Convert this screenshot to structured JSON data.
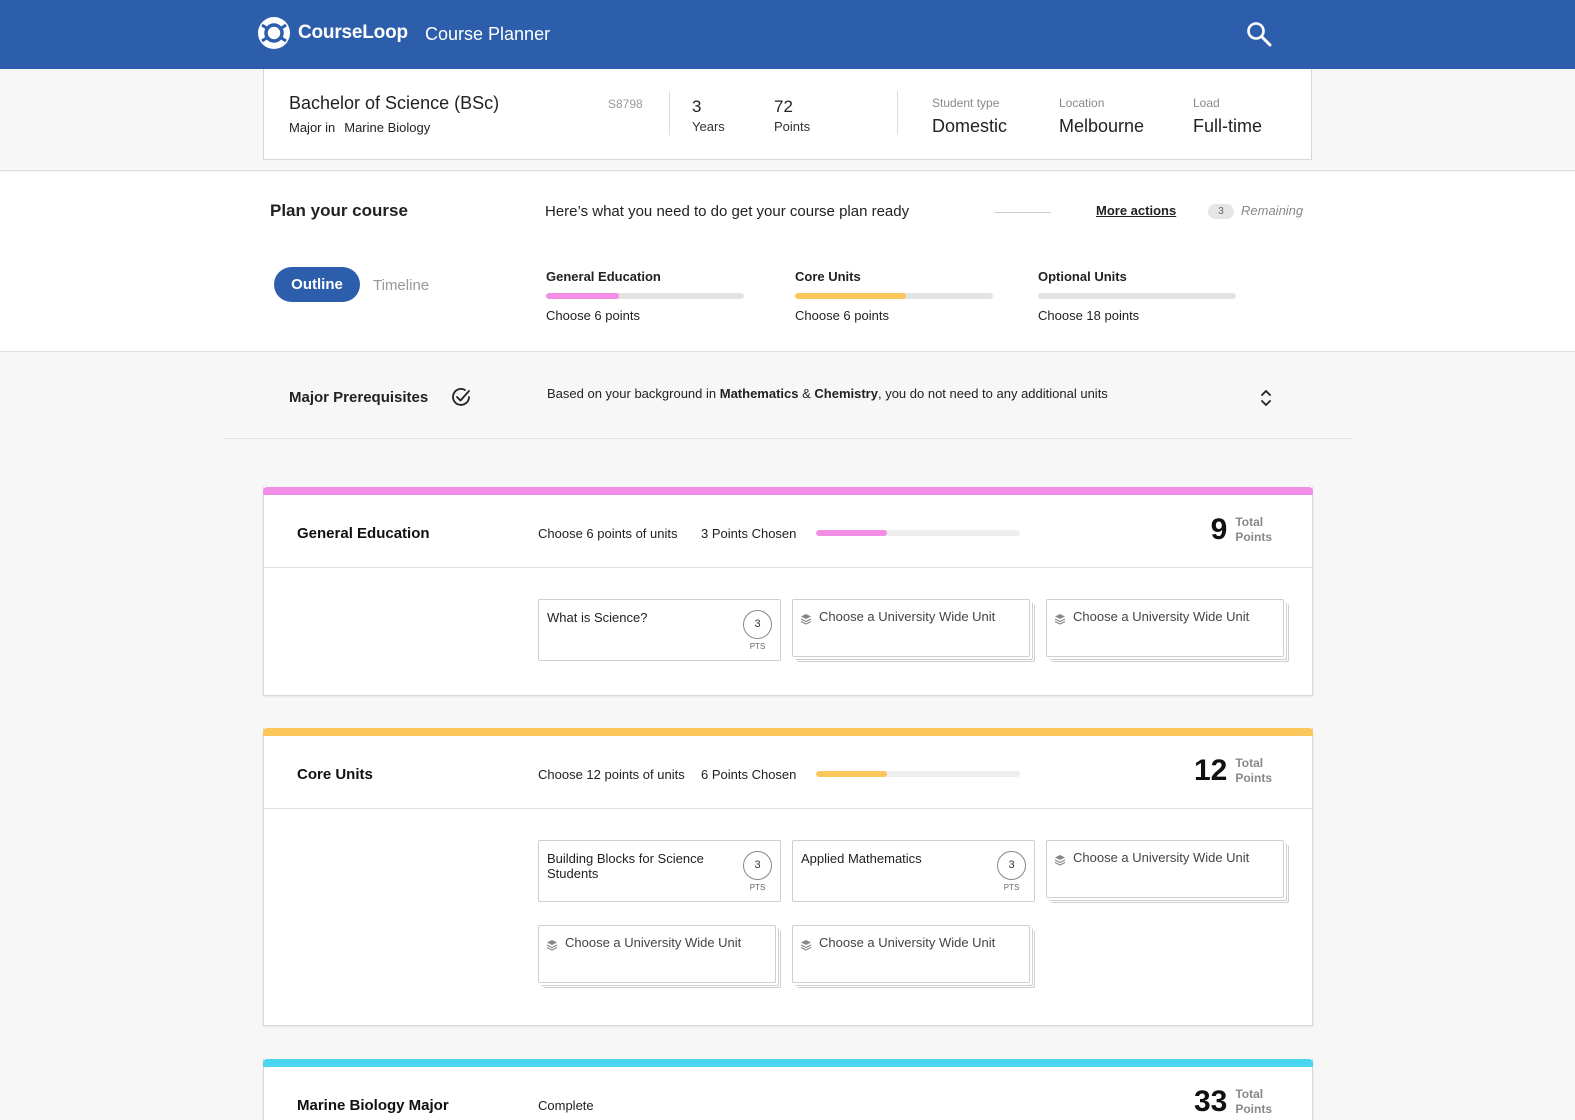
{
  "header": {
    "brand": "CourseLoop",
    "app_title": "Course Planner",
    "search_icon": "search-icon"
  },
  "summary": {
    "degree": "Bachelor of Science (BSc)",
    "major_label": "Major in",
    "major": "Marine Biology",
    "code": "S8798",
    "years_value": "3",
    "years_label": "Years",
    "points_value": "72",
    "points_label": "Points",
    "student_type_label": "Student type",
    "student_type": "Domestic",
    "location_label": "Location",
    "location": "Melbourne",
    "load_label": "Load",
    "load": "Full-time"
  },
  "plan": {
    "title": "Plan your course",
    "subtitle": "Here’s what you need to do get your course plan ready",
    "more_actions": "More actions",
    "remaining_count": "3",
    "remaining_label": "Remaining",
    "tabs": [
      {
        "label": "Outline",
        "active": true
      },
      {
        "label": "Timeline",
        "active": false
      }
    ],
    "requirements": [
      {
        "name": "General Education",
        "desc": "Choose 6 points",
        "progress": 0.37,
        "color": "#f28ee6"
      },
      {
        "name": "Core Units",
        "desc": "Choose 6 points",
        "progress": 0.56,
        "color": "#fcc75a"
      },
      {
        "name": "Optional Units",
        "desc": "Choose 18 points",
        "progress": 0,
        "color": "#4ad6f0"
      }
    ]
  },
  "prerequisites": {
    "title": "Major Prerequisites",
    "text_before": "Based on your background in ",
    "subject_1": "Mathematics",
    "text_and": " & ",
    "subject_2": "Chemistry",
    "text_after": ", you do not need to any additional units"
  },
  "groups": [
    {
      "name": "General Education",
      "accent": "#f28ee6",
      "rule": "Choose 6 points of units",
      "chosen": "3 Points Chosen",
      "progress": 0.35,
      "total": "9",
      "total_label_1": "Total",
      "total_label_2": "Points",
      "units": [
        {
          "type": "unit",
          "title": "What is Science?",
          "points": "3",
          "points_label": "PTS"
        },
        {
          "type": "choose",
          "title": "Choose a University Wide Unit"
        },
        {
          "type": "choose",
          "title": "Choose a University Wide Unit"
        }
      ]
    },
    {
      "name": "Core Units",
      "accent": "#fcc75a",
      "rule": "Choose 12 points of units",
      "chosen": "6 Points Chosen",
      "progress": 0.35,
      "total": "12",
      "total_label_1": "Total",
      "total_label_2": "Points",
      "units": [
        {
          "type": "unit",
          "title": "Building Blocks for Science Students",
          "points": "3",
          "points_label": "PTS"
        },
        {
          "type": "unit",
          "title": "Applied Mathematics",
          "points": "3",
          "points_label": "PTS"
        },
        {
          "type": "choose",
          "title": "Choose a University Wide Unit"
        },
        {
          "type": "choose",
          "title": "Choose a University Wide Unit"
        },
        {
          "type": "choose",
          "title": "Choose a University Wide Unit"
        }
      ]
    },
    {
      "name": "Marine Biology Major",
      "accent": "#4ad6f0",
      "rule": "Complete",
      "total": "33",
      "total_label_1": "Total",
      "total_label_2": "Points"
    }
  ]
}
